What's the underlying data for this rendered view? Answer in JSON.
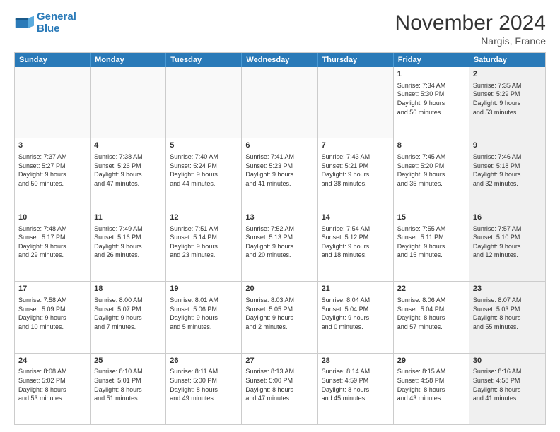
{
  "header": {
    "logo_line1": "General",
    "logo_line2": "Blue",
    "month_year": "November 2024",
    "location": "Nargis, France"
  },
  "weekdays": [
    "Sunday",
    "Monday",
    "Tuesday",
    "Wednesday",
    "Thursday",
    "Friday",
    "Saturday"
  ],
  "rows": [
    {
      "cells": [
        {
          "empty": true
        },
        {
          "empty": true
        },
        {
          "empty": true
        },
        {
          "empty": true
        },
        {
          "empty": true
        },
        {
          "day": "1",
          "info": "Sunrise: 7:34 AM\nSunset: 5:30 PM\nDaylight: 9 hours\nand 56 minutes."
        },
        {
          "day": "2",
          "info": "Sunrise: 7:35 AM\nSunset: 5:29 PM\nDaylight: 9 hours\nand 53 minutes.",
          "shaded": true
        }
      ]
    },
    {
      "cells": [
        {
          "day": "3",
          "info": "Sunrise: 7:37 AM\nSunset: 5:27 PM\nDaylight: 9 hours\nand 50 minutes."
        },
        {
          "day": "4",
          "info": "Sunrise: 7:38 AM\nSunset: 5:26 PM\nDaylight: 9 hours\nand 47 minutes."
        },
        {
          "day": "5",
          "info": "Sunrise: 7:40 AM\nSunset: 5:24 PM\nDaylight: 9 hours\nand 44 minutes."
        },
        {
          "day": "6",
          "info": "Sunrise: 7:41 AM\nSunset: 5:23 PM\nDaylight: 9 hours\nand 41 minutes."
        },
        {
          "day": "7",
          "info": "Sunrise: 7:43 AM\nSunset: 5:21 PM\nDaylight: 9 hours\nand 38 minutes."
        },
        {
          "day": "8",
          "info": "Sunrise: 7:45 AM\nSunset: 5:20 PM\nDaylight: 9 hours\nand 35 minutes."
        },
        {
          "day": "9",
          "info": "Sunrise: 7:46 AM\nSunset: 5:18 PM\nDaylight: 9 hours\nand 32 minutes.",
          "shaded": true
        }
      ]
    },
    {
      "cells": [
        {
          "day": "10",
          "info": "Sunrise: 7:48 AM\nSunset: 5:17 PM\nDaylight: 9 hours\nand 29 minutes."
        },
        {
          "day": "11",
          "info": "Sunrise: 7:49 AM\nSunset: 5:16 PM\nDaylight: 9 hours\nand 26 minutes."
        },
        {
          "day": "12",
          "info": "Sunrise: 7:51 AM\nSunset: 5:14 PM\nDaylight: 9 hours\nand 23 minutes."
        },
        {
          "day": "13",
          "info": "Sunrise: 7:52 AM\nSunset: 5:13 PM\nDaylight: 9 hours\nand 20 minutes."
        },
        {
          "day": "14",
          "info": "Sunrise: 7:54 AM\nSunset: 5:12 PM\nDaylight: 9 hours\nand 18 minutes."
        },
        {
          "day": "15",
          "info": "Sunrise: 7:55 AM\nSunset: 5:11 PM\nDaylight: 9 hours\nand 15 minutes."
        },
        {
          "day": "16",
          "info": "Sunrise: 7:57 AM\nSunset: 5:10 PM\nDaylight: 9 hours\nand 12 minutes.",
          "shaded": true
        }
      ]
    },
    {
      "cells": [
        {
          "day": "17",
          "info": "Sunrise: 7:58 AM\nSunset: 5:09 PM\nDaylight: 9 hours\nand 10 minutes."
        },
        {
          "day": "18",
          "info": "Sunrise: 8:00 AM\nSunset: 5:07 PM\nDaylight: 9 hours\nand 7 minutes."
        },
        {
          "day": "19",
          "info": "Sunrise: 8:01 AM\nSunset: 5:06 PM\nDaylight: 9 hours\nand 5 minutes."
        },
        {
          "day": "20",
          "info": "Sunrise: 8:03 AM\nSunset: 5:05 PM\nDaylight: 9 hours\nand 2 minutes."
        },
        {
          "day": "21",
          "info": "Sunrise: 8:04 AM\nSunset: 5:04 PM\nDaylight: 9 hours\nand 0 minutes."
        },
        {
          "day": "22",
          "info": "Sunrise: 8:06 AM\nSunset: 5:04 PM\nDaylight: 8 hours\nand 57 minutes."
        },
        {
          "day": "23",
          "info": "Sunrise: 8:07 AM\nSunset: 5:03 PM\nDaylight: 8 hours\nand 55 minutes.",
          "shaded": true
        }
      ]
    },
    {
      "cells": [
        {
          "day": "24",
          "info": "Sunrise: 8:08 AM\nSunset: 5:02 PM\nDaylight: 8 hours\nand 53 minutes."
        },
        {
          "day": "25",
          "info": "Sunrise: 8:10 AM\nSunset: 5:01 PM\nDaylight: 8 hours\nand 51 minutes."
        },
        {
          "day": "26",
          "info": "Sunrise: 8:11 AM\nSunset: 5:00 PM\nDaylight: 8 hours\nand 49 minutes."
        },
        {
          "day": "27",
          "info": "Sunrise: 8:13 AM\nSunset: 5:00 PM\nDaylight: 8 hours\nand 47 minutes."
        },
        {
          "day": "28",
          "info": "Sunrise: 8:14 AM\nSunset: 4:59 PM\nDaylight: 8 hours\nand 45 minutes."
        },
        {
          "day": "29",
          "info": "Sunrise: 8:15 AM\nSunset: 4:58 PM\nDaylight: 8 hours\nand 43 minutes."
        },
        {
          "day": "30",
          "info": "Sunrise: 8:16 AM\nSunset: 4:58 PM\nDaylight: 8 hours\nand 41 minutes.",
          "shaded": true
        }
      ]
    }
  ]
}
